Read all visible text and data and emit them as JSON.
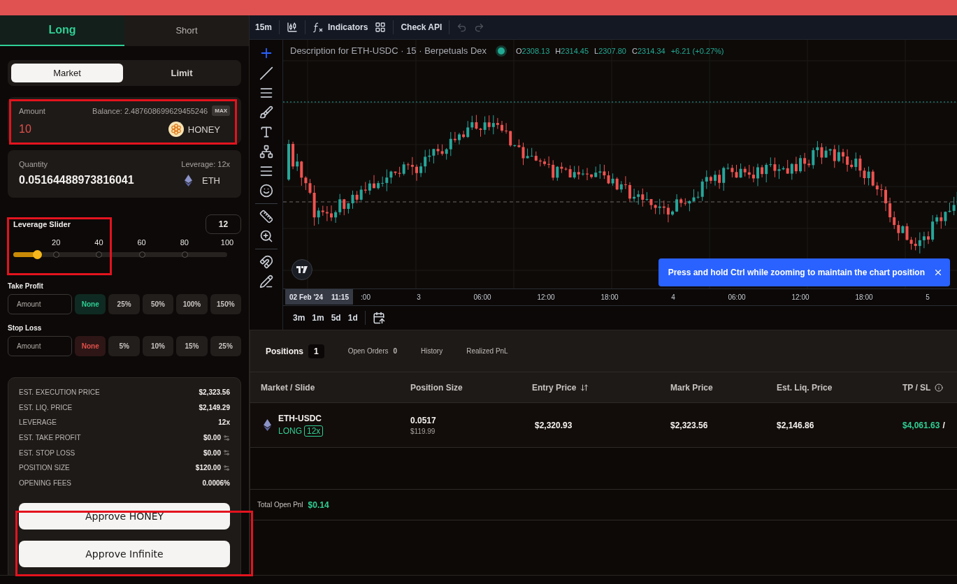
{
  "side_tabs": [
    {
      "label": "Long",
      "selected": true
    },
    {
      "label": "Short",
      "selected": false
    }
  ],
  "order_types": [
    {
      "label": "Market",
      "selected": true
    },
    {
      "label": "Limit",
      "selected": false
    }
  ],
  "amount": {
    "label": "Amount",
    "balance": "Balance: 2.487608699629455246",
    "max": "MAX",
    "value": "10",
    "token": "HONEY"
  },
  "quantity": {
    "label": "Quantity",
    "leverage": "Leverage: 12x",
    "value": "0.05164488973816041",
    "token": "ETH"
  },
  "leverage_slider": {
    "label": "Leverage Slider",
    "value": "12",
    "ticks": [
      "20",
      "40",
      "60",
      "80",
      "100"
    ],
    "level": 0.11
  },
  "triggers": [
    {
      "kind": "profit",
      "label": "Take Profit",
      "placeholder": "Amount",
      "options": [
        {
          "label": "None",
          "selected": true
        },
        {
          "label": "25%",
          "selected": false
        },
        {
          "label": "50%",
          "selected": false
        },
        {
          "label": "100%",
          "selected": false
        },
        {
          "label": "150%",
          "selected": false
        }
      ]
    },
    {
      "kind": "loss",
      "label": "Stop Loss",
      "placeholder": "Amount",
      "options": [
        {
          "label": "None",
          "selected": true
        },
        {
          "label": "5%",
          "selected": false
        },
        {
          "label": "10%",
          "selected": false
        },
        {
          "label": "15%",
          "selected": false
        },
        {
          "label": "25%",
          "selected": false
        }
      ]
    }
  ],
  "summary": [
    {
      "label": "EST. EXECUTION PRICE",
      "value": "$2,323.56",
      "icon": false
    },
    {
      "label": "EST. LIQ. PRICE",
      "value": "$2,149.29",
      "icon": false
    },
    {
      "label": "LEVERAGE",
      "value": "12x",
      "icon": false
    },
    {
      "label": "EST. TAKE PROFIT",
      "value": "$0.00",
      "icon": true
    },
    {
      "label": "EST. STOP LOSS",
      "value": "$0.00",
      "icon": true
    },
    {
      "label": "POSITION SIZE",
      "value": "$120.00",
      "icon": true
    },
    {
      "label": "OPENING FEES",
      "value": "0.0006%",
      "icon": false
    }
  ],
  "buttons": [
    "Approve HONEY",
    "Approve Infinite"
  ],
  "chart_toolbar": {
    "interval": "15m",
    "indicators": "Indicators",
    "check_api": "Check API"
  },
  "legend": {
    "title": "Description for ETH-USDC · 15 · Berpetuals Dex",
    "ohlc": [
      {
        "key": "O",
        "value": "2308.13"
      },
      {
        "key": "H",
        "value": "2314.45"
      },
      {
        "key": "L",
        "value": "2307.80"
      },
      {
        "key": "C",
        "value": "2314.34"
      }
    ],
    "change": "+6.21 (+0.27%)"
  },
  "time_axis": {
    "cursor_date": "02 Feb '24",
    "cursor_time": "11:15",
    "labels": [
      ":00",
      "3",
      "06:00",
      "12:00",
      "18:00",
      "4",
      "06:00",
      "12:00",
      "18:00",
      "5"
    ]
  },
  "ranges": [
    "3m",
    "1m",
    "5d",
    "1d"
  ],
  "toast": "Press and hold Ctrl while zooming to maintain the chart position",
  "positions_tabs": [
    {
      "label": "Positions",
      "count": "1",
      "selected": true
    },
    {
      "label": "Open Orders",
      "count": "0",
      "selected": false
    },
    {
      "label": "History",
      "selected": false
    },
    {
      "label": "Realized PnL",
      "selected": false
    }
  ],
  "table": {
    "columns": [
      {
        "label": "Market / Slide",
        "kind": "plain"
      },
      {
        "label": "Position Size",
        "kind": "plain"
      },
      {
        "label": "Entry Price",
        "kind": "sortable"
      },
      {
        "label": "Mark Price",
        "kind": "plain"
      },
      {
        "label": "Est. Liq. Price",
        "kind": "plain"
      },
      {
        "label": "TP / SL",
        "kind": "info"
      }
    ],
    "rows": [
      {
        "market": "ETH-USDC",
        "side": "LONG",
        "leverage": "12x",
        "size": "0.0517",
        "size_usd": "$119.99",
        "entry": "$2,320.93",
        "mark": "$2,323.56",
        "liq": "$2,146.86",
        "tp": "$4,061.63",
        "separator": "/"
      }
    ]
  },
  "total_pnl": {
    "label": "Total Open Pnl",
    "value": "$0.14"
  }
}
